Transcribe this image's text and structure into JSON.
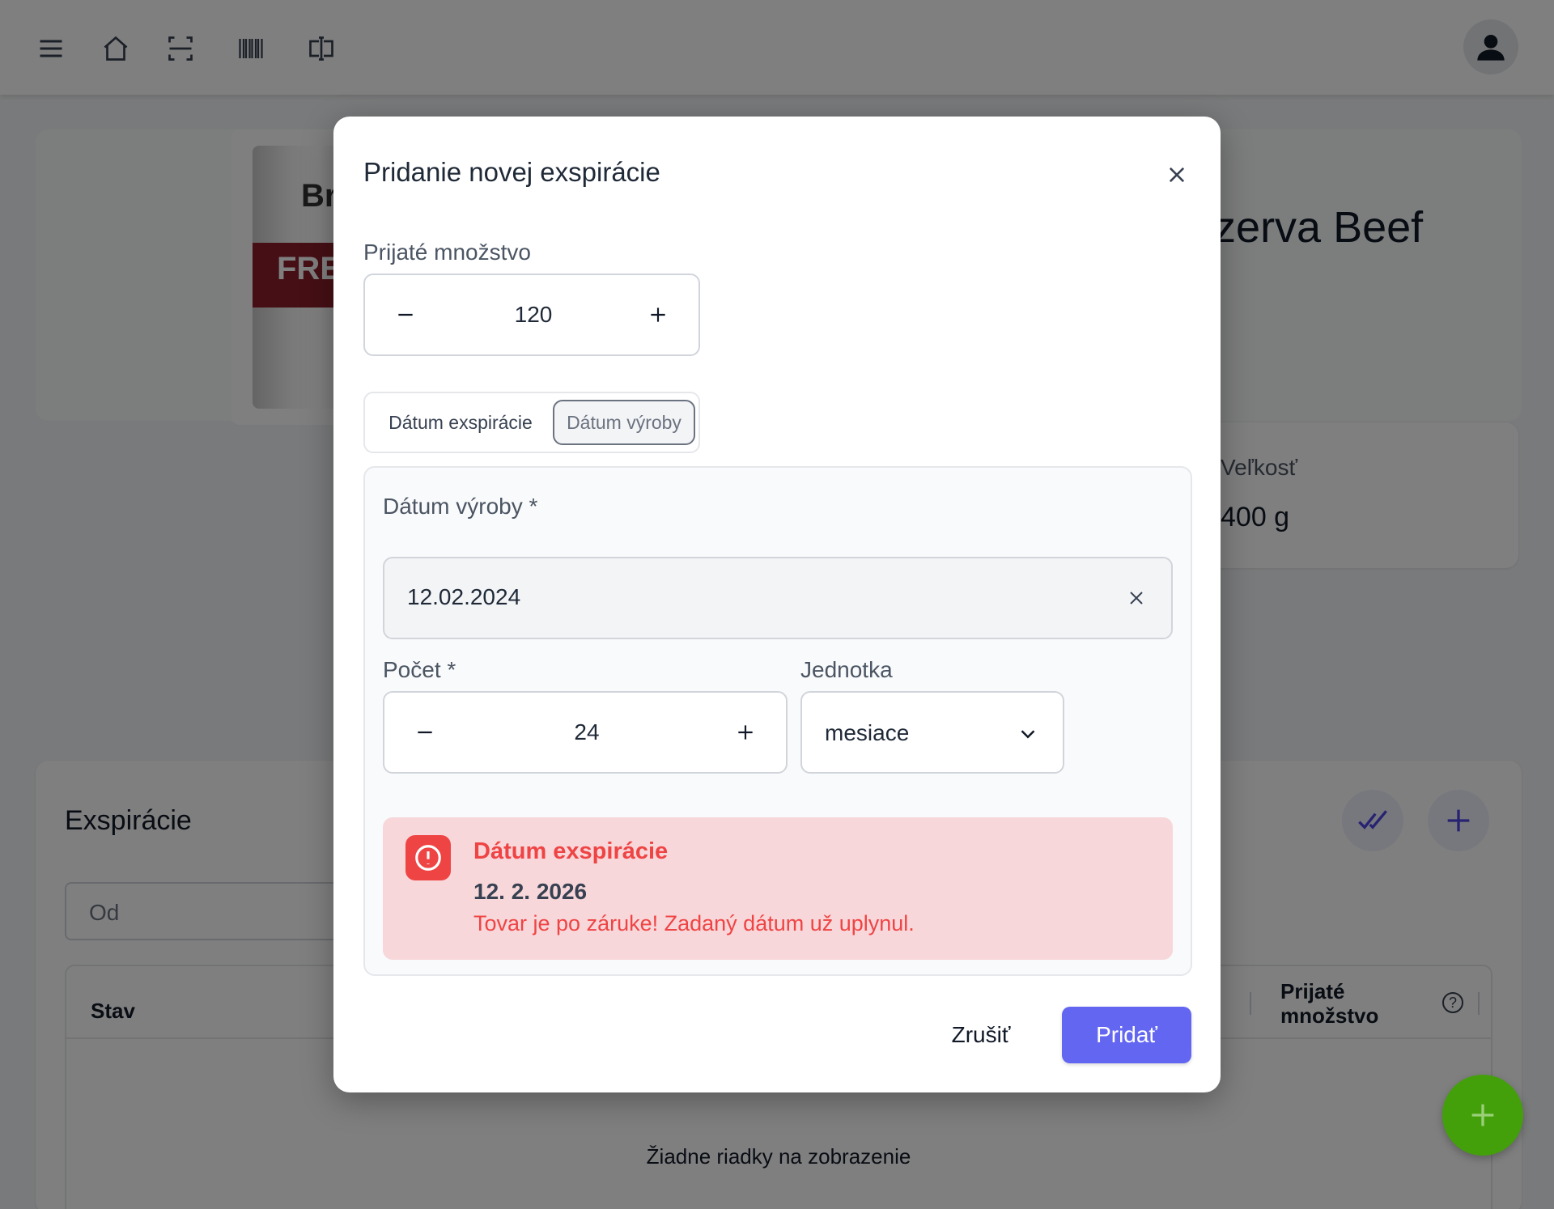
{
  "background": {
    "product": {
      "title_fragment": "nzerva Beef",
      "size_label": "Veľkosť",
      "size_value": "400 g",
      "can_brand": "Br",
      "can_text": "FRE"
    },
    "expirations": {
      "title": "Exspirácie",
      "from_placeholder": "Od",
      "col_status": "Stav",
      "col_received_qty": "Prijaté množstvo",
      "help_symbol": "?",
      "empty_text": "Žiadne riadky na zobrazenie"
    }
  },
  "modal": {
    "title": "Pridanie novej exspirácie",
    "received_qty_label": "Prijaté množstvo",
    "received_qty_value": "120",
    "toggle": {
      "options": [
        "Dátum exspirácie",
        "Dátum výroby"
      ],
      "selected": "Dátum výroby"
    },
    "production_date_label": "Dátum výroby *",
    "production_date_value": "12.02.2024",
    "count_label": "Počet *",
    "count_value": "24",
    "unit_label": "Jednotka",
    "unit_value": "mesiace",
    "alert": {
      "title": "Dátum exspirácie",
      "date": "12. 2. 2026",
      "message": "Tovar je po záruke! Zadaný dátum už uplynul."
    },
    "cancel_label": "Zrušiť",
    "submit_label": "Pridať"
  },
  "colors": {
    "primary": "#6366f1",
    "danger": "#ef4444",
    "danger_bg": "#f8d7da",
    "fab": "#43a00a"
  },
  "icons": [
    "menu-icon",
    "home-icon",
    "scan-icon",
    "barcode-icon",
    "text-cursor-icon",
    "user-icon",
    "close-icon",
    "minus-icon",
    "plus-icon",
    "chevron-down-icon",
    "alert-circle-icon",
    "double-check-icon"
  ]
}
